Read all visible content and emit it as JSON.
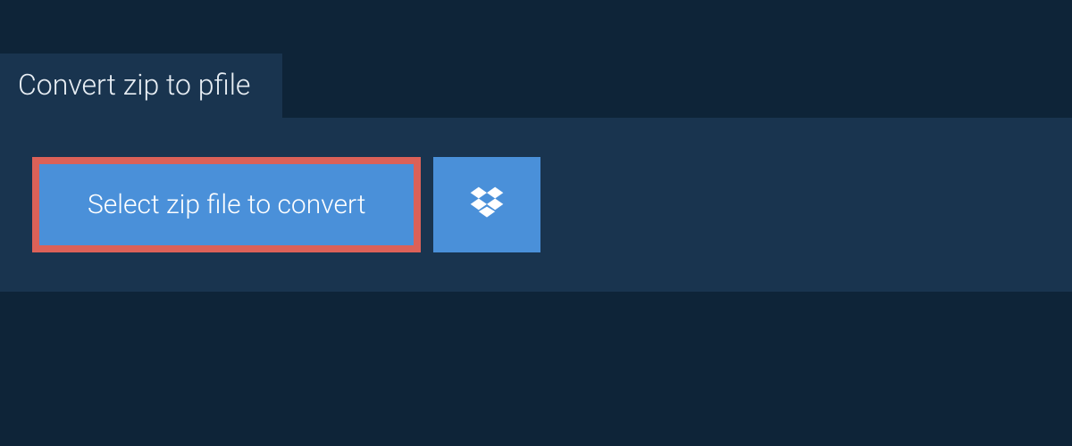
{
  "tab": {
    "title": "Convert zip to pfile"
  },
  "actions": {
    "select_file_label": "Select zip file to convert"
  },
  "colors": {
    "page_bg": "#0e2438",
    "panel_bg": "#19344f",
    "button_bg": "#4a90d9",
    "button_border": "#dc6158",
    "text_light": "#e8eef4"
  }
}
